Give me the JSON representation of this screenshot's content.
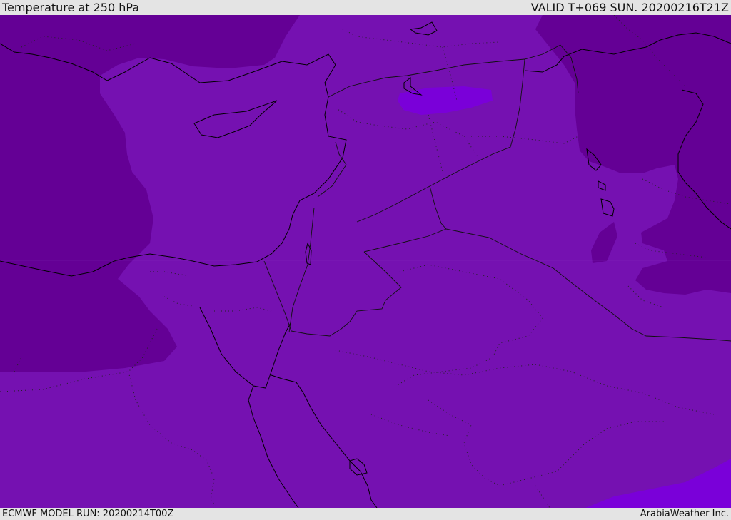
{
  "header": {
    "title": "Temperature at 250 hPa",
    "valid_time": "VALID T+069 SUN. 20200216T21Z"
  },
  "footer": {
    "model_run": "ECMWF MODEL RUN: 20200214T00Z",
    "credit": "ArabiaWeather Inc."
  },
  "colors": {
    "field_mid": "#7511b1",
    "field_cold": "#640095",
    "field_warm": "#7a00d9",
    "bar_bg": "#e4e4e4"
  }
}
